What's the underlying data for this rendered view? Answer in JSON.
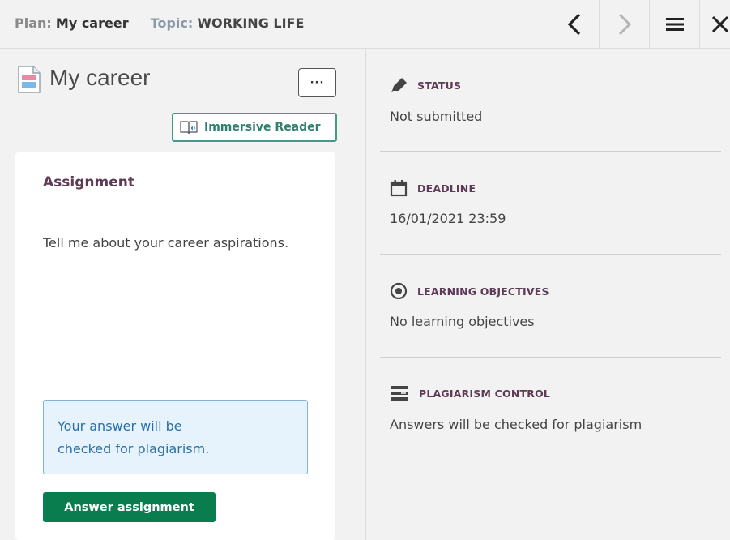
{
  "header": {
    "plan_label": "Plan:",
    "plan_value": "My career",
    "topic_label": "Topic:",
    "topic_value": "WORKING LIFE",
    "icons": {
      "prev": "chevron-left-icon",
      "next": "chevron-right-icon",
      "menu": "hamburger-menu-icon",
      "close": "close-icon"
    }
  },
  "assignment_panel": {
    "title": "My career",
    "more_label": "···",
    "immersive_reader_label": "Immersive Reader",
    "card": {
      "heading": "Assignment",
      "body": "Tell me about your career aspirations.",
      "notice_line1": "Your answer will be",
      "notice_line2": "checked for plagiarism.",
      "answer_button": "Answer assignment"
    }
  },
  "details": {
    "status": {
      "label": "STATUS",
      "value": "Not submitted",
      "icon": "pencil-icon"
    },
    "deadline": {
      "label": "DEADLINE",
      "value": "16/01/2021 23:59",
      "icon": "calendar-icon"
    },
    "objectives": {
      "label": "LEARNING OBJECTIVES",
      "value": "No learning objectives",
      "icon": "target-icon"
    },
    "plagiarism": {
      "label": "PLAGIARISM CONTROL",
      "value": "Answers will be checked for plagiarism",
      "icon": "plagiarism-icon"
    }
  },
  "colors": {
    "accent_purple": "#5d3a55",
    "answer_green": "#0a7d4f",
    "reader_teal": "#3f9c8a",
    "notice_blue": "#2a6fa8"
  }
}
